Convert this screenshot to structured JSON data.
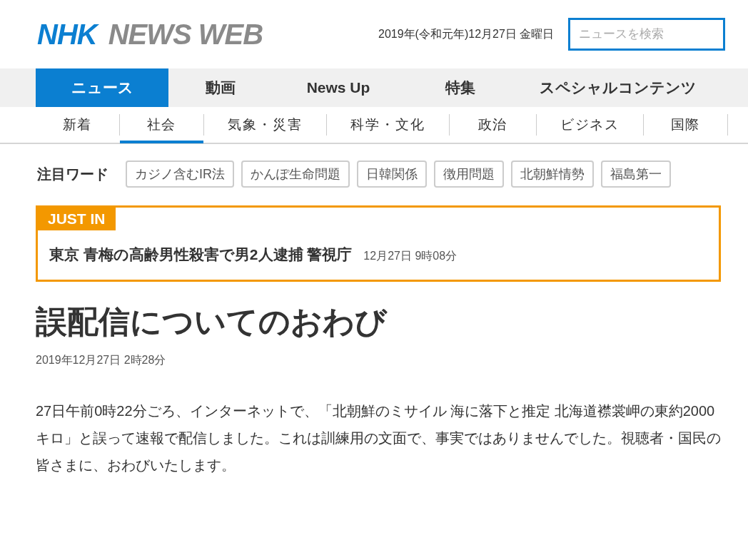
{
  "logo": {
    "brand": "NHK",
    "name": "NEWS WEB"
  },
  "date": "2019年(令和元年)12月27日 金曜日",
  "search": {
    "placeholder": "ニュースを検索"
  },
  "main_nav": [
    {
      "label": "ニュース",
      "selected": true
    },
    {
      "label": "動画",
      "selected": false
    },
    {
      "label": "News Up",
      "selected": false
    },
    {
      "label": "特集",
      "selected": false
    },
    {
      "label": "スペシャルコンテンツ",
      "selected": false
    }
  ],
  "sub_nav": [
    {
      "label": "新着",
      "selected": false
    },
    {
      "label": "社会",
      "selected": true
    },
    {
      "label": "気象・災害",
      "selected": false
    },
    {
      "label": "科学・文化",
      "selected": false
    },
    {
      "label": "政治",
      "selected": false
    },
    {
      "label": "ビジネス",
      "selected": false
    },
    {
      "label": "国際",
      "selected": false
    }
  ],
  "keywords": {
    "label": "注目ワード",
    "tags": [
      "カジノ含むIR法",
      "かんぽ生命問題",
      "日韓関係",
      "徴用問題",
      "北朝鮮情勢",
      "福島第一"
    ]
  },
  "just_in": {
    "badge": "JUST IN",
    "headline": "東京 青梅の高齢男性殺害で男2人逮捕 警視庁",
    "time": "12月27日 9時08分"
  },
  "article": {
    "title": "誤配信についてのおわび",
    "date": "2019年12月27日 2時28分",
    "body": "27日午前0時22分ごろ、インターネットで、「北朝鮮のミサイル 海に落下と推定 北海道襟裳岬の東約2000キロ」と誤って速報で配信しました。これは訓練用の文面で、事実ではありませんでした。視聴者・国民の皆さまに、おわびいたします。"
  }
}
